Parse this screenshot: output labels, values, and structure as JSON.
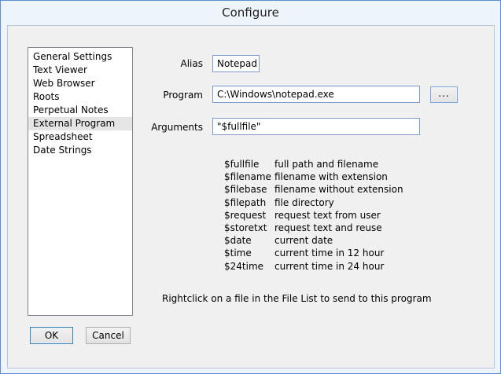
{
  "window": {
    "title": "Configure"
  },
  "sidebar": {
    "items": [
      {
        "label": "General Settings"
      },
      {
        "label": "Text Viewer"
      },
      {
        "label": "Web Browser"
      },
      {
        "label": "Roots"
      },
      {
        "label": "Perpetual Notes"
      },
      {
        "label": "External Program",
        "selected": true
      },
      {
        "label": "Spreadsheet"
      },
      {
        "label": "Date Strings"
      }
    ]
  },
  "form": {
    "alias_label": "Alias",
    "alias_value": "Notepad",
    "program_label": "Program",
    "program_value": "C:\\Windows\\notepad.exe",
    "browse_label": "...",
    "arguments_label": "Arguments",
    "arguments_value": "\"$fullfile\""
  },
  "variables": [
    {
      "name": "$fullfile",
      "desc": "full path and filename"
    },
    {
      "name": "$filename",
      "desc": "filename with extension"
    },
    {
      "name": "$filebase",
      "desc": "filename without extension"
    },
    {
      "name": "$filepath",
      "desc": "file directory"
    },
    {
      "name": "$request",
      "desc": "request text from user"
    },
    {
      "name": "$storetxt",
      "desc": "request text and reuse"
    },
    {
      "name": "$date",
      "desc": "current date"
    },
    {
      "name": "$time",
      "desc": "current time in 12 hour"
    },
    {
      "name": "$24time",
      "desc": "current time in 24 hour"
    }
  ],
  "hint": "Rightclick on a file in the File List to send to this program",
  "buttons": {
    "ok": "OK",
    "cancel": "Cancel"
  },
  "colors": {
    "window_frame": "#eef4fb",
    "field_border": "#7a9cd3",
    "selection": "#e5e5e5"
  }
}
